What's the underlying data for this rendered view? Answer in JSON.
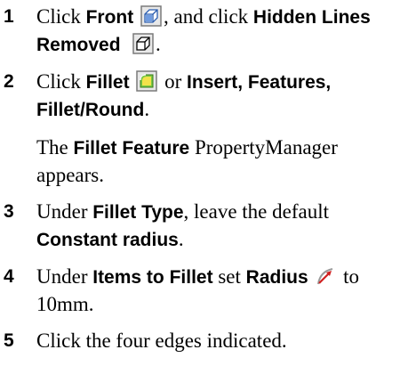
{
  "steps": [
    {
      "number": "1",
      "t1": "Click ",
      "b1": "Front",
      "icon1": "front-view-icon",
      "t2": ", and click ",
      "b2": "Hidden Lines Removed",
      "icon2": "hidden-lines-removed-icon",
      "t3": "."
    },
    {
      "number": "2",
      "t1": "Click ",
      "b1": "Fillet",
      "icon1": "fillet-icon",
      "t2": " or ",
      "b2": "Insert, Features, Fillet/Round",
      "t3": "."
    },
    {
      "number": "3",
      "t1": "Under ",
      "b1": "Fillet Type",
      "t2": ", leave the default ",
      "b2": "Constant radius",
      "t3": "."
    },
    {
      "number": "4",
      "t1": "Under ",
      "b1": "Items to Fillet",
      "t2": " set ",
      "b2": "Radius",
      "icon1": "radius-icon",
      "t3": " to 10mm."
    },
    {
      "number": "5",
      "t1": "Click the four edges indicated."
    }
  ],
  "note": {
    "t1": "The ",
    "b1": "Fillet Feature",
    "t2": " PropertyManager appears."
  },
  "colors": {
    "text": "#000000",
    "icon_border": "#7a7a7a",
    "icon_fill": "#e8e8e8",
    "icon_blue": "#2a5db0",
    "fillet_green": "#7ac943",
    "fillet_yellow": "#f2e24a",
    "radius_red": "#d02020"
  }
}
